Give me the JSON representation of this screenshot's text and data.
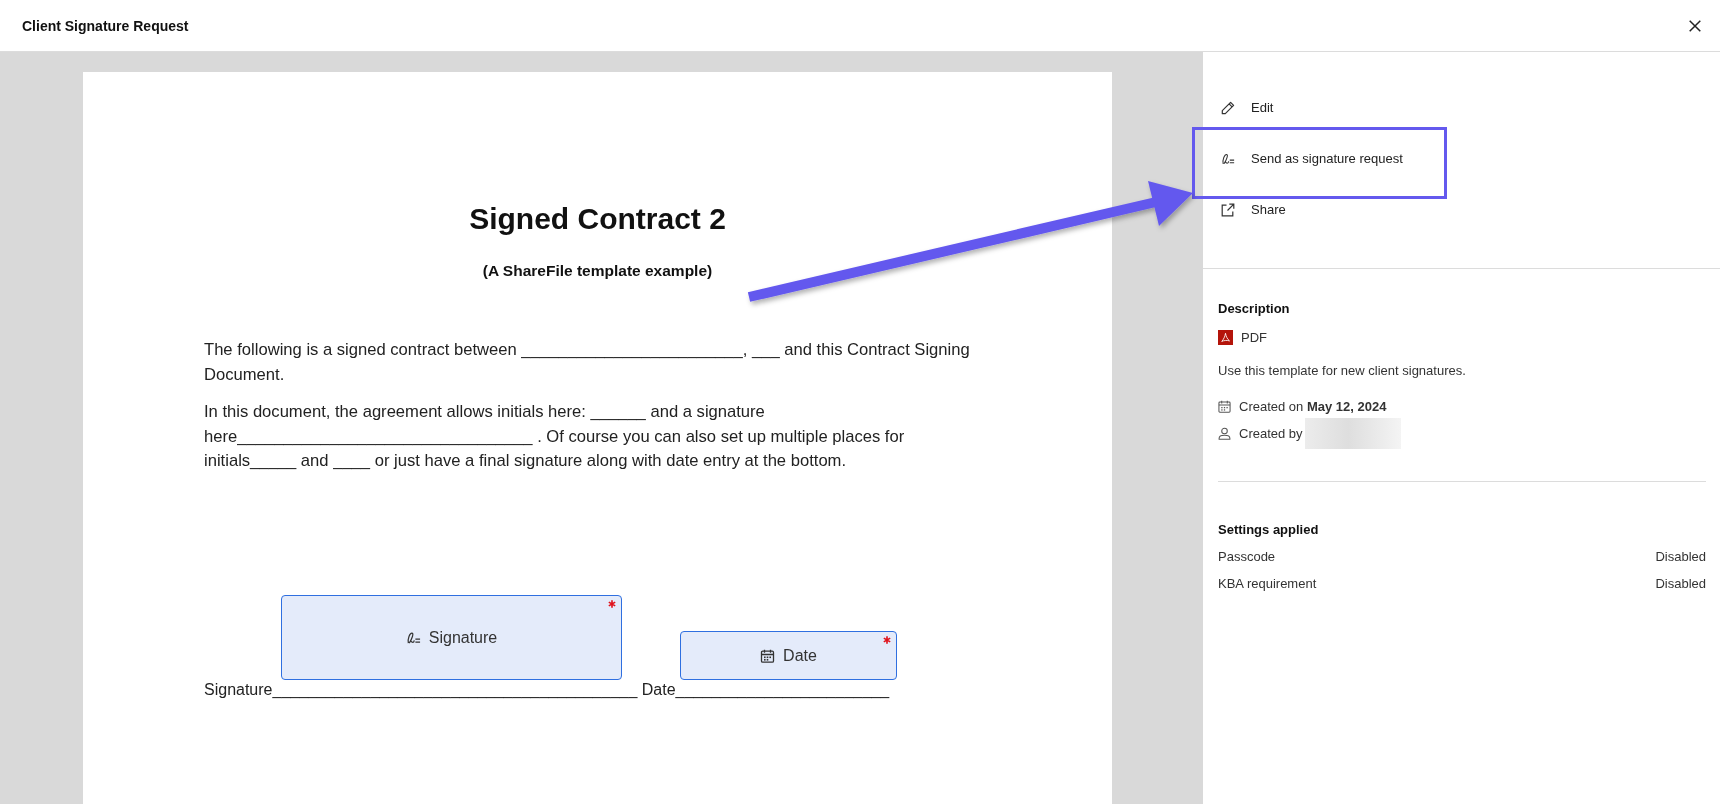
{
  "window": {
    "title": "Client Signature Request"
  },
  "document": {
    "title": "Signed Contract 2",
    "subtitle": "(A ShareFile template example)",
    "paragraphs": [
      {
        "lines": [
          "The following is a signed contract between ________________________, ___ and this Contract Signing",
          "Document."
        ]
      },
      {
        "lines": [
          "In this document, the agreement allows initials here: ______ and a signature",
          "here________________________________ . Of course you can also set up multiple places for",
          "initials_____ and ____ or just have a final signature along with date entry at the bottom."
        ]
      }
    ],
    "signature_line": "Signature_________________________________________ Date________________________",
    "fields": [
      {
        "kind": "signature",
        "label": "Signature",
        "required": true
      },
      {
        "kind": "date",
        "label": "Date",
        "required": true
      }
    ]
  },
  "actions": [
    {
      "kind": "edit",
      "label": "Edit",
      "highlighted": false
    },
    {
      "kind": "signature",
      "label": "Send as signature request",
      "highlighted": true
    },
    {
      "kind": "share",
      "label": "Share",
      "highlighted": false
    }
  ],
  "description": {
    "heading": "Description",
    "file_type": "PDF",
    "text": "Use this template for new client signatures.",
    "created_on": "Created on **May 12, 2024**",
    "created_by": "Created by"
  },
  "settings": {
    "heading": "Settings applied",
    "rows": [
      {
        "label": "Passcode",
        "value": "Disabled"
      },
      {
        "label": "KBA requirement",
        "value": "Disabled"
      }
    ]
  }
}
